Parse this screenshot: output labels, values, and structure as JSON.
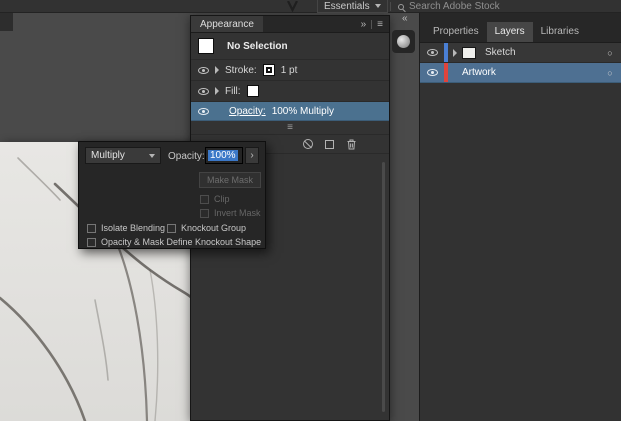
{
  "top_bar": {
    "workspace_button": "Essentials",
    "search_placeholder": "Search Adobe Stock"
  },
  "appearance": {
    "title": "Appearance",
    "no_selection": "No Selection",
    "stroke_label": "Stroke:",
    "stroke_value": "1 pt",
    "fill_label": "Fill:",
    "opacity_label": "Opacity:",
    "opacity_value": "100% Multiply"
  },
  "popup": {
    "blend_mode": "Multiply",
    "opacity_label": "Opacity:",
    "opacity_value": "100%",
    "make_mask": "Make Mask",
    "clip": "Clip",
    "clip_checked": false,
    "invert_mask": "Invert Mask",
    "invert_mask_checked": false,
    "isolate_blending": "Isolate Blending",
    "isolate_blending_checked": false,
    "knockout_group": "Knockout Group",
    "knockout_group_checked": false,
    "define_knockout": "Opacity & Mask Define Knockout Shape",
    "define_knockout_checked": false
  },
  "dock": {
    "tabs": [
      {
        "label": "Properties",
        "active": false
      },
      {
        "label": "Layers",
        "active": true
      },
      {
        "label": "Libraries",
        "active": false
      }
    ],
    "layers": [
      {
        "name": "Sketch",
        "color": "#4a7fd4",
        "visible": true
      },
      {
        "name": "Artwork",
        "color": "#e0443c",
        "visible": true,
        "selected": true
      }
    ]
  },
  "icons": {
    "menu": "≡",
    "panel_collapse": "»",
    "dock_collapse": "«",
    "stepper": "›",
    "target_circle": "○",
    "list": "≡"
  },
  "colors": {
    "selection_blue": "#4b718f",
    "text_selection": "#3b78c8",
    "panel_bg": "#333333",
    "canvas_bg": "#4a4a4a"
  }
}
